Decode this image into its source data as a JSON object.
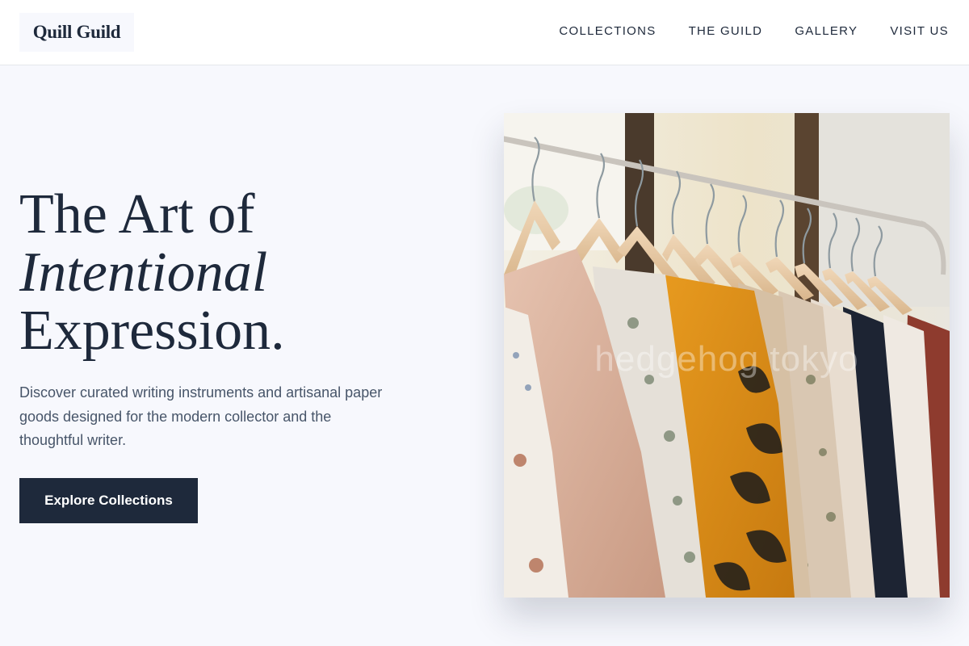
{
  "header": {
    "logo": "Quill Guild",
    "nav": [
      "COLLECTIONS",
      "THE GUILD",
      "GALLERY",
      "VISIT US"
    ]
  },
  "hero": {
    "title_line1": "The Art of",
    "title_line2": "Intentional",
    "title_line3": "Expression.",
    "description": "Discover curated writing instruments and artisanal paper goods designed for the modern collector and the thoughtful writer.",
    "cta_label": "Explore Collections"
  },
  "image": {
    "subject": "clothing rack with garments on wooden hangers",
    "watermark": "hedgehog tokyo"
  },
  "colors": {
    "page_bg": "#f7f8fd",
    "header_bg": "#ffffff",
    "primary": "#1e293b",
    "body_text": "#475569"
  }
}
